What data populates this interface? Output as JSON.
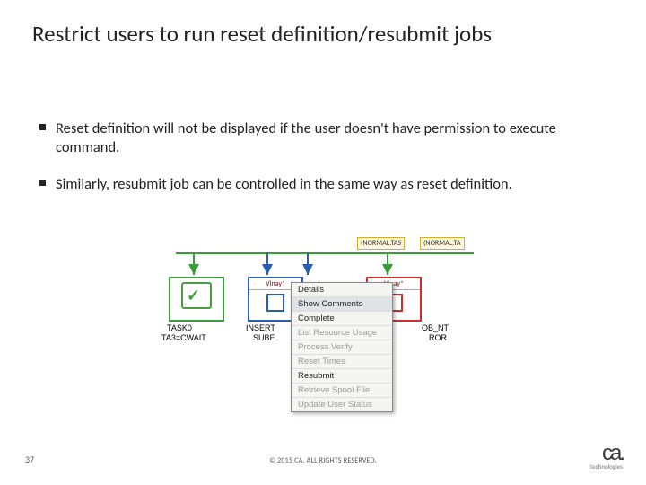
{
  "title": "Restrict users to run reset definition/resubmit jobs",
  "bullets": [
    "Reset definition will not be displayed if the user doesn't have permission to execute command.",
    "Similarly, resubmit job can be controlled in the same way as reset definition."
  ],
  "diagram": {
    "tags": [
      "(NORMAL,TAS",
      "(NORMAL,TA"
    ],
    "tasks": [
      {
        "name": "TASK0",
        "status": "TA3=CWAIT"
      },
      {
        "name": "INSERT",
        "status": "SUBE"
      },
      {
        "name": "OB_NT",
        "status": "ROR"
      }
    ],
    "task_header": "Vinay*",
    "menu": [
      {
        "label": "Details",
        "disabled": false
      },
      {
        "label": "Show Comments",
        "disabled": false
      },
      {
        "label": "Complete",
        "disabled": false
      },
      {
        "label": "List Resource Usage",
        "disabled": true
      },
      {
        "label": "Process Verify",
        "disabled": true
      },
      {
        "label": "Reset Times",
        "disabled": true
      },
      {
        "label": "Resubmit",
        "disabled": false
      },
      {
        "label": "Retrieve Spool File",
        "disabled": true
      },
      {
        "label": "Update User Status",
        "disabled": true
      }
    ]
  },
  "footer": {
    "page": "37",
    "copyright": "© 2015 CA. ALL RIGHTS RESERVED.",
    "logo_text": "ca",
    "logo_tag": "technologies"
  }
}
